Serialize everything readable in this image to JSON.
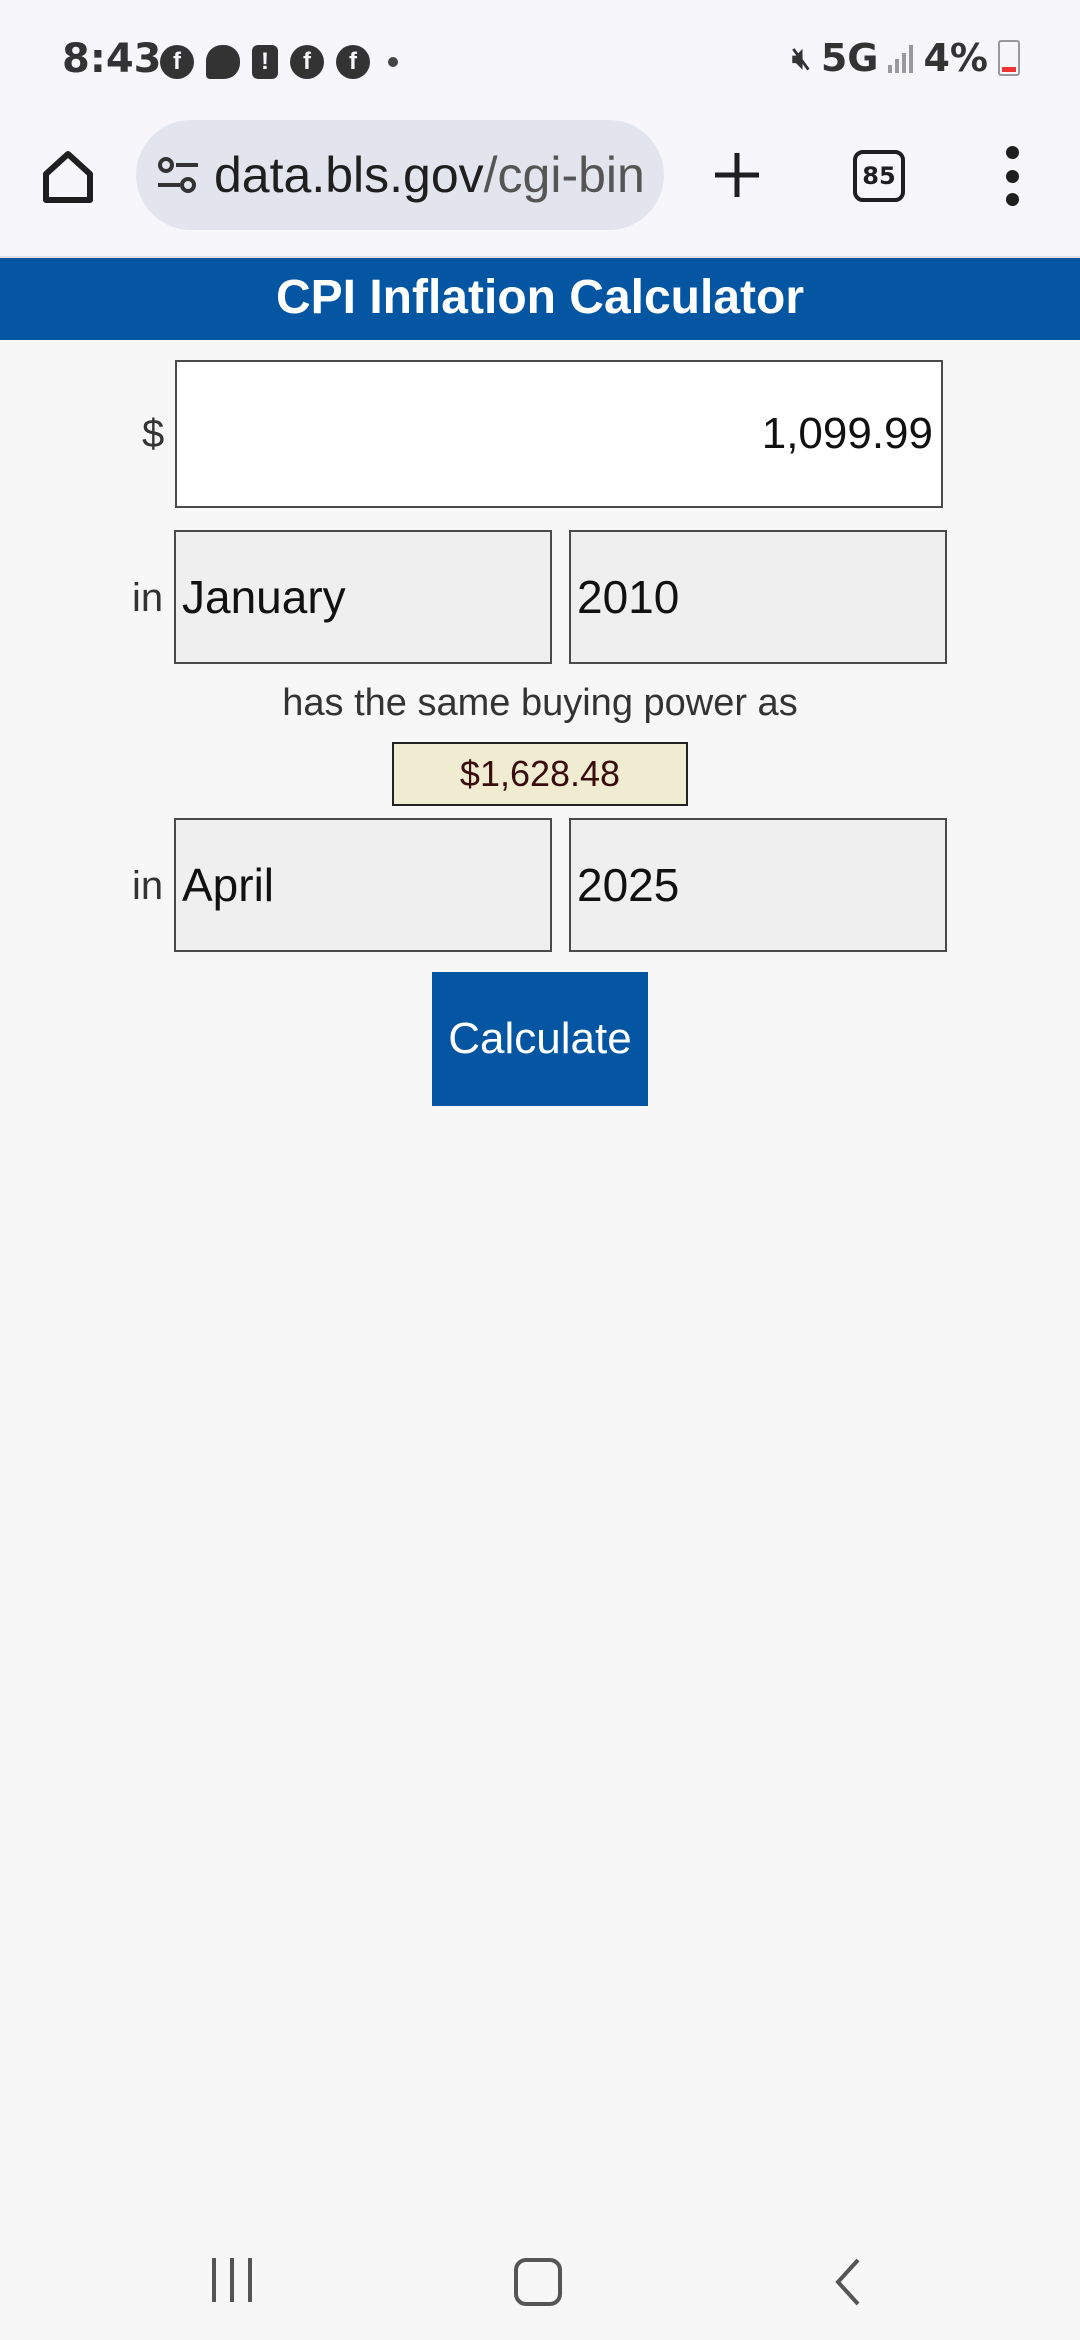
{
  "status_bar": {
    "time": "8:43",
    "network": "5G",
    "battery_percent": "4%",
    "notification_icons": [
      "facebook-icon",
      "chat-icon",
      "alert-icon",
      "facebook-icon",
      "facebook-icon"
    ]
  },
  "browser": {
    "url_host": "data.bls.gov",
    "url_path": "/cgi-bin",
    "tab_count": "85"
  },
  "page": {
    "title": "CPI Inflation Calculator",
    "currency_symbol": "$",
    "amount_value": "1,099.99",
    "in_label": "in",
    "from_month": "January",
    "from_year": "2010",
    "same_power_text": "has the same buying power as",
    "result": "$1,628.48",
    "to_month": "April",
    "to_year": "2025",
    "calculate_label": "Calculate"
  },
  "colors": {
    "header_blue": "#0556a2",
    "result_bg": "#efecd2"
  }
}
